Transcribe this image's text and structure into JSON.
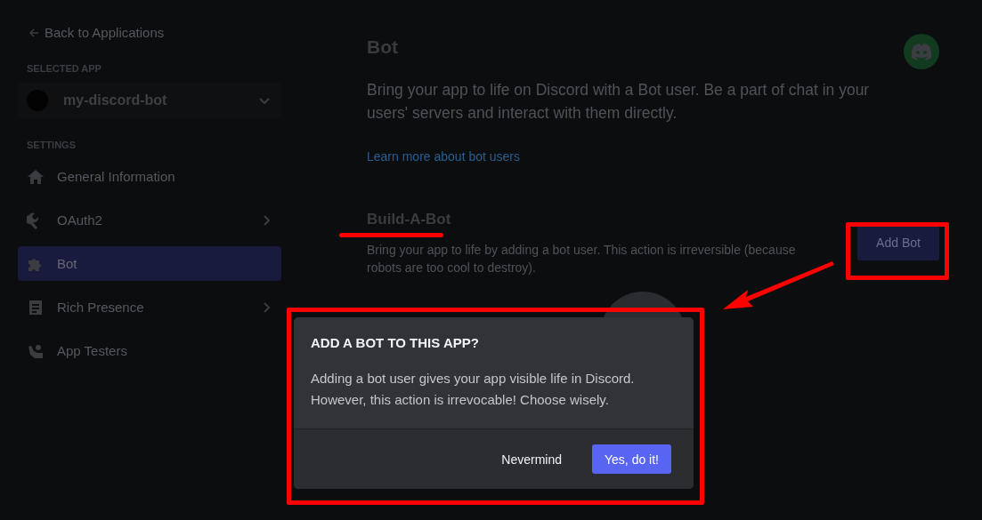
{
  "sidebar": {
    "back_link": "Back to Applications",
    "selected_app_label": "SELECTED APP",
    "selected_app": "my-discord-bot",
    "settings_label": "SETTINGS",
    "items": [
      {
        "label": "General Information",
        "selected": false,
        "expandable": false
      },
      {
        "label": "OAuth2",
        "selected": false,
        "expandable": true
      },
      {
        "label": "Bot",
        "selected": true,
        "expandable": false
      },
      {
        "label": "Rich Presence",
        "selected": false,
        "expandable": true
      },
      {
        "label": "App Testers",
        "selected": false,
        "expandable": false
      }
    ]
  },
  "main": {
    "title": "Bot",
    "description": "Bring your app to life on Discord with a Bot user. Be a part of chat in your users' servers and interact with them directly.",
    "link": "Learn more about bot users",
    "section": {
      "title": "Build-A-Bot",
      "description": "Bring your app to life by adding a bot user. This action is irreversible (because robots are too cool to destroy).",
      "button": "Add Bot"
    }
  },
  "dialog": {
    "title": "ADD A BOT TO THIS APP?",
    "body": "Adding a bot user gives your app visible life in Discord. However, this action is irrevocable! Choose wisely.",
    "cancel": "Nevermind",
    "confirm": "Yes, do it!"
  }
}
